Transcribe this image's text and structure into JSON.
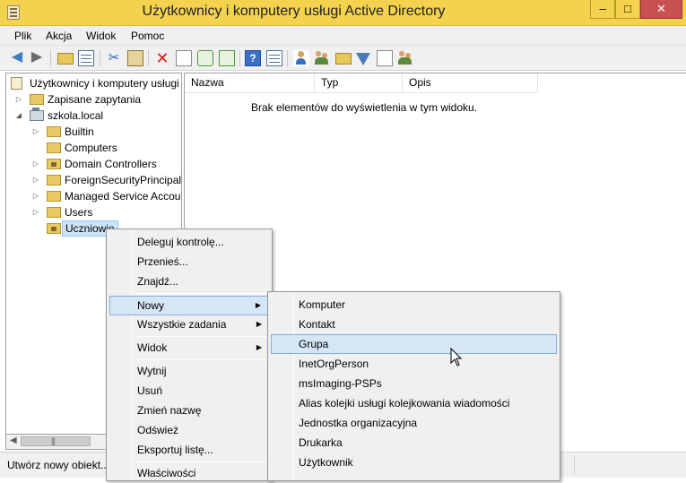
{
  "window": {
    "title": "Użytkownicy i komputery usługi Active Directory",
    "controls": {
      "minimize": "–",
      "maximize": "□",
      "close": "✕"
    }
  },
  "menubar": {
    "items": [
      "Plik",
      "Akcja",
      "Widok",
      "Pomoc"
    ]
  },
  "toolbar": {
    "icons": [
      "back-arrow-icon",
      "forward-arrow-icon",
      "up-folder-icon",
      "show-tree-icon",
      "cut-icon",
      "paste-icon",
      "delete-icon",
      "properties-icon",
      "refresh-icon",
      "export-list-icon",
      "help-icon",
      "view-icon",
      "new-user-icon",
      "new-group-icon",
      "new-ou-icon",
      "filter-icon",
      "find-icon",
      "add-to-group-icon"
    ]
  },
  "tree": {
    "root": "Użytkownicy i komputery usługi Active Directory",
    "saved_queries": "Zapisane zapytania",
    "domain": "szkola.local",
    "children": [
      "Builtin",
      "Computers",
      "Domain Controllers",
      "ForeignSecurityPrincipals",
      "Managed Service Accounts",
      "Users",
      "Uczniowie"
    ],
    "selected": "Uczniowie"
  },
  "list": {
    "columns": [
      "Nazwa",
      "Typ",
      "Opis"
    ],
    "empty_message": "Brak elementów do wyświetlenia w tym widoku."
  },
  "status": {
    "text": "Utwórz nowy obiekt..."
  },
  "context_menu": {
    "items": [
      "Deleguj kontrolę...",
      "Przenieś...",
      "Znajdź...",
      "Nowy",
      "Wszystkie zadania",
      "Widok",
      "Wytnij",
      "Usuń",
      "Zmień nazwę",
      "Odśwież",
      "Eksportuj listę...",
      "Właściwości"
    ],
    "highlighted": "Nowy"
  },
  "submenu_new": {
    "items": [
      "Komputer",
      "Kontakt",
      "Grupa",
      "InetOrgPerson",
      "msImaging-PSPs",
      "Alias kolejki usługi kolejkowania wiadomości",
      "Jednostka organizacyjna",
      "Drukarka",
      "Użytkownik"
    ],
    "highlighted": "Grupa"
  },
  "colors": {
    "titlebar": "#f3d34d",
    "highlight": "#d5e6f7",
    "selection": "#cce4f7"
  }
}
